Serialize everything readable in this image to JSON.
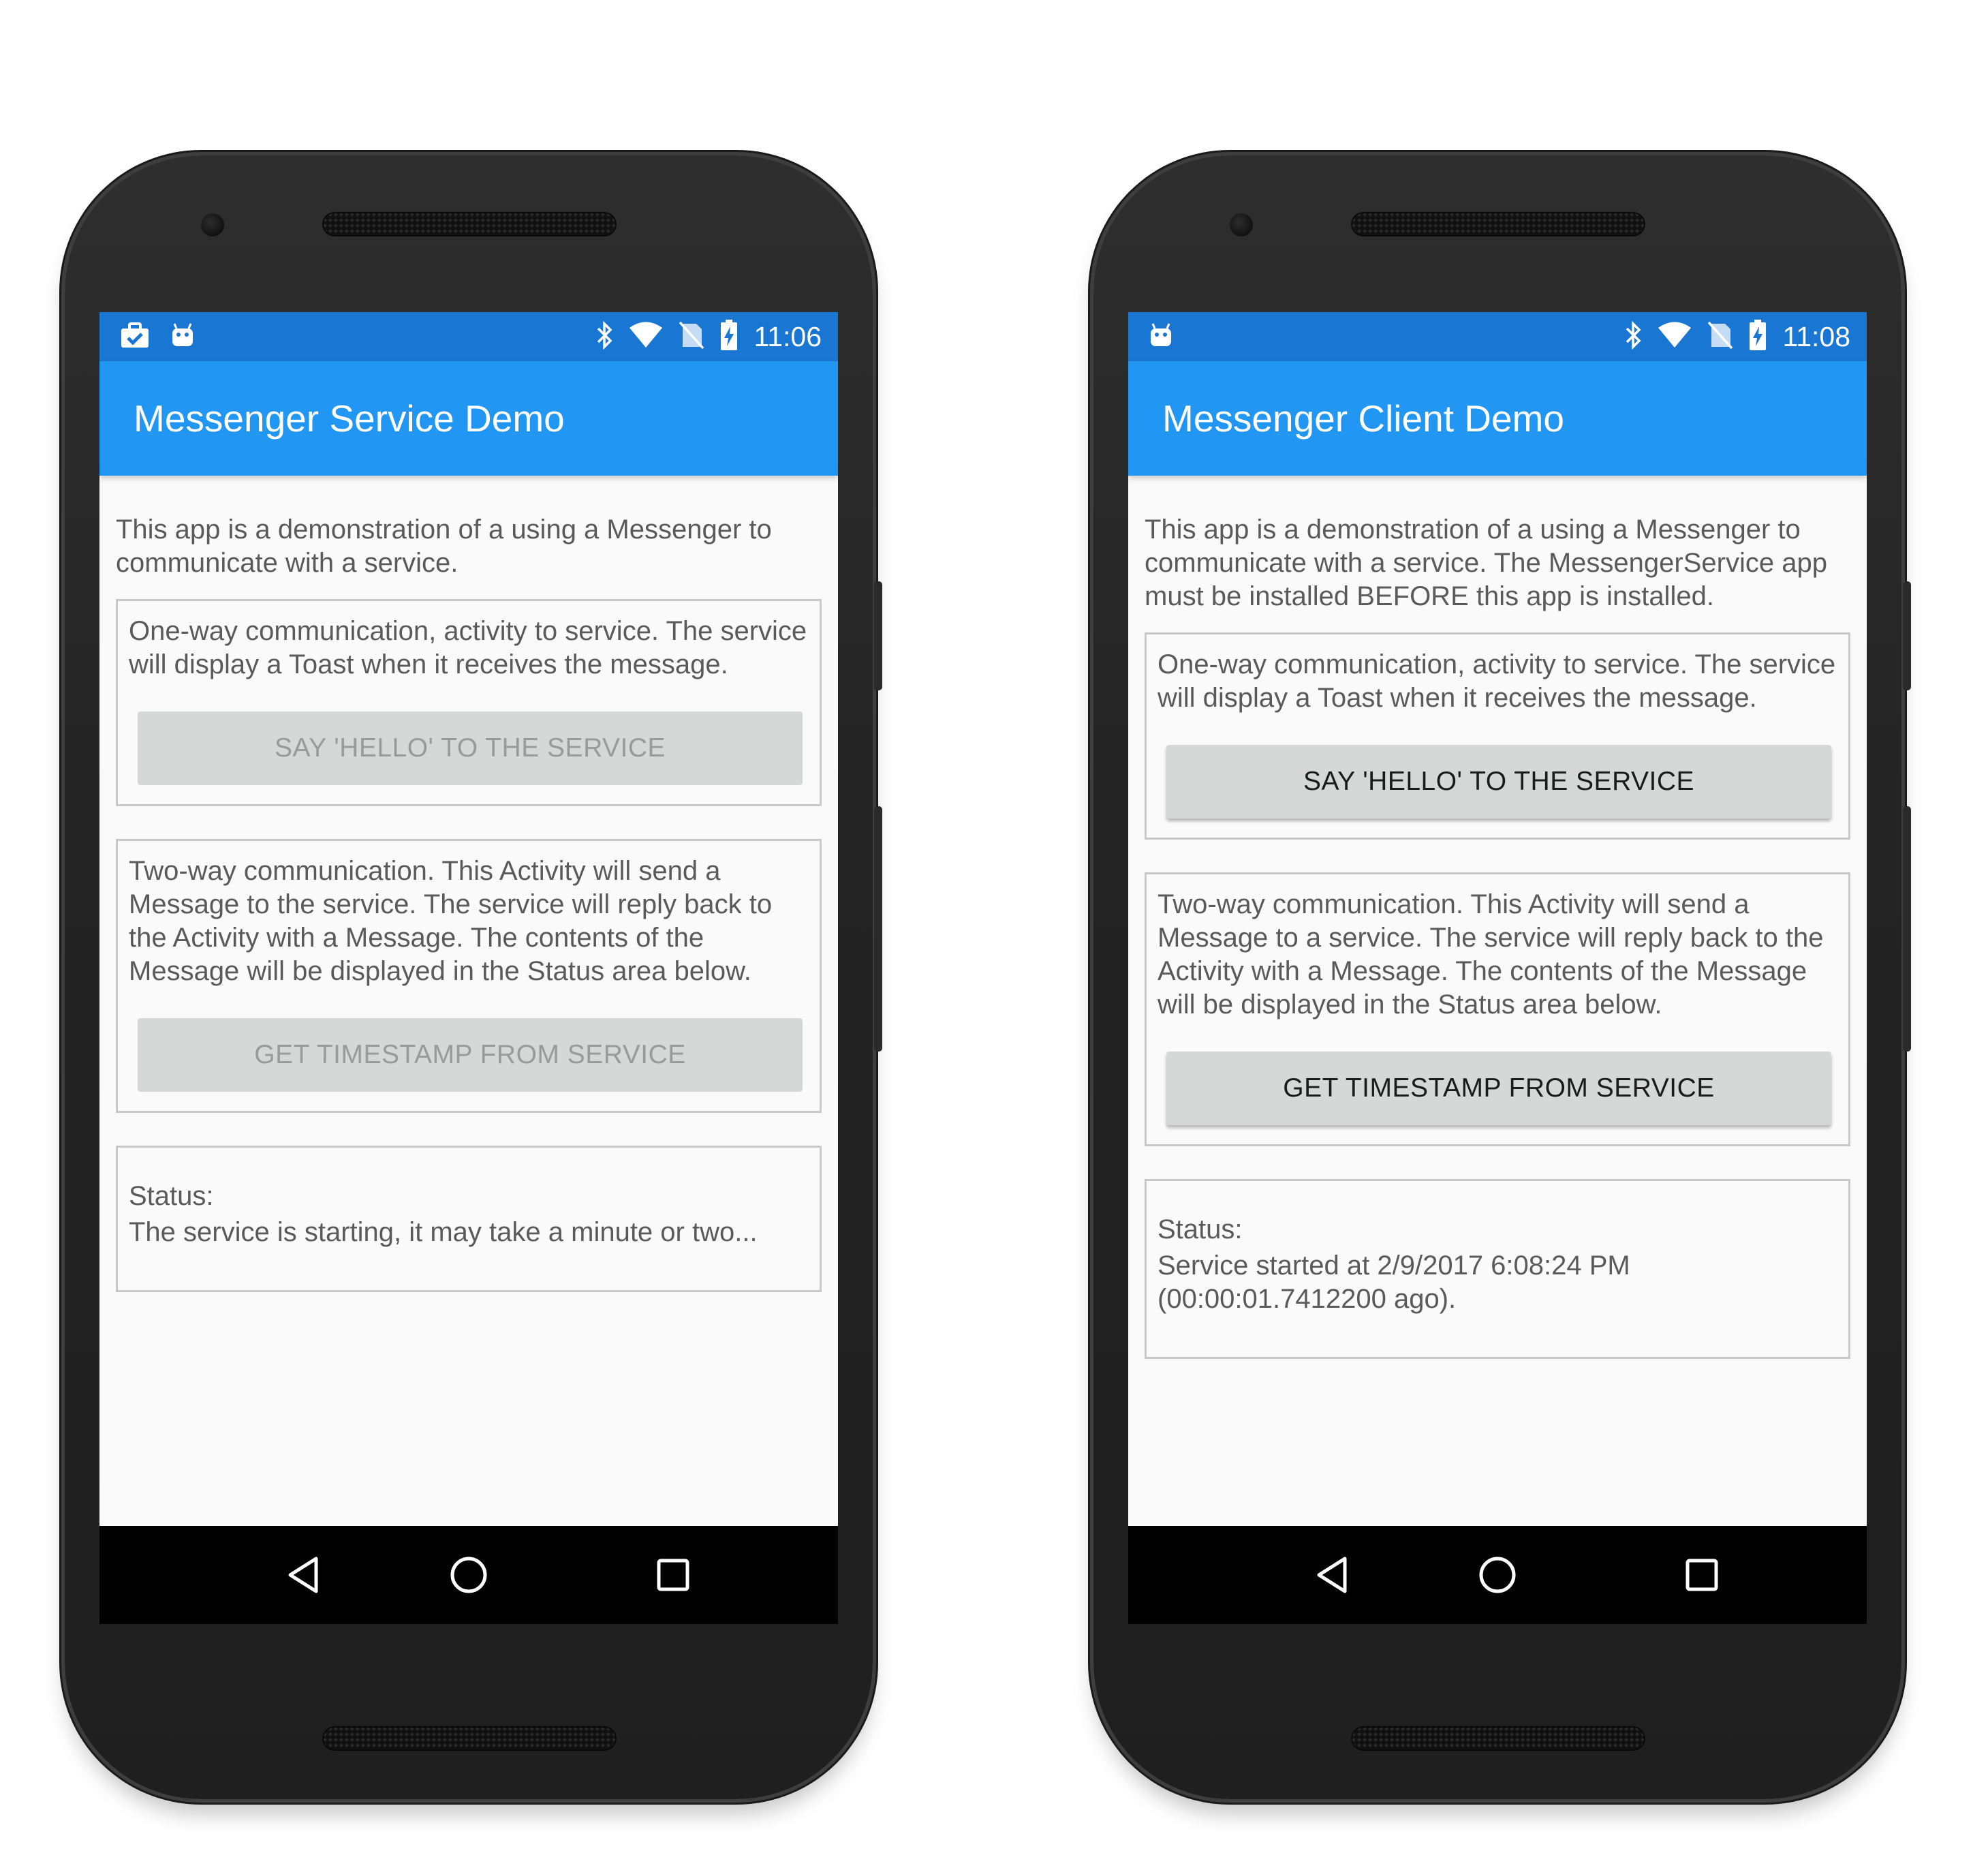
{
  "phones": [
    {
      "status_bar": {
        "time": "11:06",
        "left_icons": [
          "work-notification-icon",
          "android-debug-icon"
        ],
        "right_icons": [
          "bluetooth-icon",
          "wifi-icon",
          "no-sim-icon",
          "battery-charging-icon"
        ]
      },
      "app_title": "Messenger Service Demo",
      "intro": "This app is a demonstration of a using a Messenger to communicate with a service.",
      "card1": {
        "text": "One-way communication, activity to service. The service will display a Toast when it receives the message.",
        "button": "SAY 'HELLO' TO THE SERVICE",
        "button_enabled": false
      },
      "card2": {
        "text": "Two-way communication. This Activity will send a Message to the service. The service will reply back to the Activity with a Message. The contents of the Message will be displayed in the Status area below.",
        "button": "GET TIMESTAMP FROM SERVICE",
        "button_enabled": false
      },
      "status": {
        "label": "Status:",
        "text": "The service is starting, it may take a minute or two..."
      }
    },
    {
      "status_bar": {
        "time": "11:08",
        "left_icons": [
          "android-debug-icon"
        ],
        "right_icons": [
          "bluetooth-icon",
          "wifi-icon",
          "no-sim-icon",
          "battery-charging-icon"
        ]
      },
      "app_title": "Messenger Client Demo",
      "intro": "This app is a demonstration of a using a Messenger to communicate with a service. The MessengerService app must be installed BEFORE this app is installed.",
      "card1": {
        "text": "One-way communication, activity to service. The service will display a Toast when it receives the message.",
        "button": "SAY 'HELLO' TO THE SERVICE",
        "button_enabled": true
      },
      "card2": {
        "text": "Two-way communication. This Activity will send a Message to a service. The service will reply back to the Activity with a Message. The contents of the Message will be displayed in the Status area below.",
        "button": "GET TIMESTAMP FROM SERVICE",
        "button_enabled": true
      },
      "status": {
        "label": "Status:",
        "text": "Service started at 2/9/2017 6:08:24 PM (00:00:01.7412200 ago)."
      }
    }
  ],
  "colors": {
    "status_bar": "#1976d2",
    "app_bar": "#2196f3",
    "button_bg": "#d6d7d7",
    "text": "#5a5a5a"
  }
}
